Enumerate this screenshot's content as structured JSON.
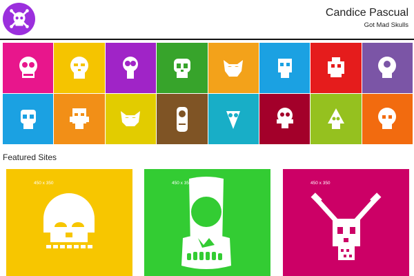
{
  "header": {
    "logo_icon": "purple-skull-crossbones-logo",
    "name": "Candice Pascual",
    "tagline": "Got Mad Skulls"
  },
  "colors": {
    "logo": "#9b2fdd",
    "rule": "#111111"
  },
  "skull_grid": [
    {
      "icon": "skull-icon-1",
      "color": "#e8168c"
    },
    {
      "icon": "skull-icon-2",
      "color": "#f5c400"
    },
    {
      "icon": "skull-icon-3",
      "color": "#a024c7"
    },
    {
      "icon": "skull-icon-4",
      "color": "#37a42b"
    },
    {
      "icon": "skull-icon-5",
      "color": "#f3a21a"
    },
    {
      "icon": "skull-icon-6",
      "color": "#1ba1e2"
    },
    {
      "icon": "skull-icon-7",
      "color": "#e51c1c"
    },
    {
      "icon": "skull-icon-8",
      "color": "#7b55a6"
    },
    {
      "icon": "skull-icon-9",
      "color": "#1ba1e2"
    },
    {
      "icon": "skull-icon-10",
      "color": "#f28f17"
    },
    {
      "icon": "skull-icon-11",
      "color": "#e2cc00"
    },
    {
      "icon": "skull-icon-12",
      "color": "#7f5425"
    },
    {
      "icon": "skull-icon-13",
      "color": "#18aec7"
    },
    {
      "icon": "skull-icon-14",
      "color": "#a3002a"
    },
    {
      "icon": "skull-icon-15",
      "color": "#95c11f"
    },
    {
      "icon": "skull-icon-16",
      "color": "#f26b0f"
    }
  ],
  "featured": {
    "title": "Featured Sites",
    "items": [
      {
        "label": "450 x 350",
        "icon": "featured-skull-1",
        "color": "#f7c600"
      },
      {
        "label": "450 x 350",
        "icon": "featured-skull-2",
        "color": "#33cc33"
      },
      {
        "label": "450 x 350",
        "icon": "featured-skull-3",
        "color": "#cc0066"
      }
    ]
  }
}
